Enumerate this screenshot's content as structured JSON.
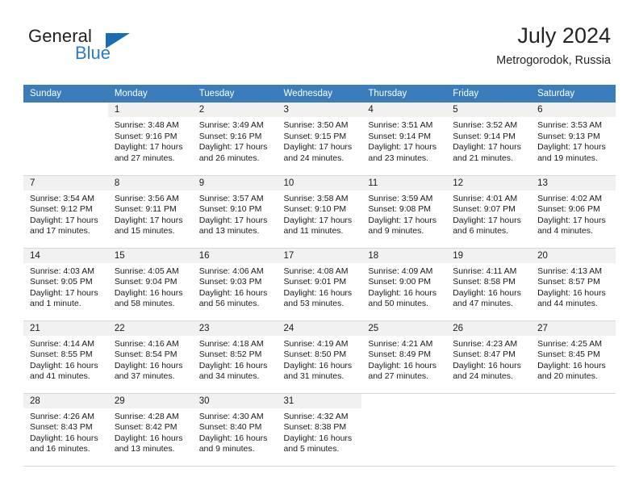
{
  "brand": {
    "name_top": "General",
    "name_bottom": "Blue",
    "triangle_icon": "brand-triangle-icon",
    "accent_color": "#2b7cc4"
  },
  "header": {
    "title": "July 2024",
    "subtitle": "Metrogorodok, Russia"
  },
  "theme": {
    "header_row_bg": "#3b7cba",
    "day_number_bg": "#f1f1f1",
    "grid_line": "#d7d7d7",
    "text": "#1a1a1a"
  },
  "weekday_headers": [
    "Sunday",
    "Monday",
    "Tuesday",
    "Wednesday",
    "Thursday",
    "Friday",
    "Saturday"
  ],
  "weeks": [
    [
      {
        "day": "",
        "sunrise": "",
        "sunset": "",
        "daylight_line1": "",
        "daylight_line2": "",
        "blank": true
      },
      {
        "day": "1",
        "sunrise": "Sunrise: 3:48 AM",
        "sunset": "Sunset: 9:16 PM",
        "daylight_line1": "Daylight: 17 hours",
        "daylight_line2": "and 27 minutes."
      },
      {
        "day": "2",
        "sunrise": "Sunrise: 3:49 AM",
        "sunset": "Sunset: 9:16 PM",
        "daylight_line1": "Daylight: 17 hours",
        "daylight_line2": "and 26 minutes."
      },
      {
        "day": "3",
        "sunrise": "Sunrise: 3:50 AM",
        "sunset": "Sunset: 9:15 PM",
        "daylight_line1": "Daylight: 17 hours",
        "daylight_line2": "and 24 minutes."
      },
      {
        "day": "4",
        "sunrise": "Sunrise: 3:51 AM",
        "sunset": "Sunset: 9:14 PM",
        "daylight_line1": "Daylight: 17 hours",
        "daylight_line2": "and 23 minutes."
      },
      {
        "day": "5",
        "sunrise": "Sunrise: 3:52 AM",
        "sunset": "Sunset: 9:14 PM",
        "daylight_line1": "Daylight: 17 hours",
        "daylight_line2": "and 21 minutes."
      },
      {
        "day": "6",
        "sunrise": "Sunrise: 3:53 AM",
        "sunset": "Sunset: 9:13 PM",
        "daylight_line1": "Daylight: 17 hours",
        "daylight_line2": "and 19 minutes."
      }
    ],
    [
      {
        "day": "7",
        "sunrise": "Sunrise: 3:54 AM",
        "sunset": "Sunset: 9:12 PM",
        "daylight_line1": "Daylight: 17 hours",
        "daylight_line2": "and 17 minutes."
      },
      {
        "day": "8",
        "sunrise": "Sunrise: 3:56 AM",
        "sunset": "Sunset: 9:11 PM",
        "daylight_line1": "Daylight: 17 hours",
        "daylight_line2": "and 15 minutes."
      },
      {
        "day": "9",
        "sunrise": "Sunrise: 3:57 AM",
        "sunset": "Sunset: 9:10 PM",
        "daylight_line1": "Daylight: 17 hours",
        "daylight_line2": "and 13 minutes."
      },
      {
        "day": "10",
        "sunrise": "Sunrise: 3:58 AM",
        "sunset": "Sunset: 9:10 PM",
        "daylight_line1": "Daylight: 17 hours",
        "daylight_line2": "and 11 minutes."
      },
      {
        "day": "11",
        "sunrise": "Sunrise: 3:59 AM",
        "sunset": "Sunset: 9:08 PM",
        "daylight_line1": "Daylight: 17 hours",
        "daylight_line2": "and 9 minutes."
      },
      {
        "day": "12",
        "sunrise": "Sunrise: 4:01 AM",
        "sunset": "Sunset: 9:07 PM",
        "daylight_line1": "Daylight: 17 hours",
        "daylight_line2": "and 6 minutes."
      },
      {
        "day": "13",
        "sunrise": "Sunrise: 4:02 AM",
        "sunset": "Sunset: 9:06 PM",
        "daylight_line1": "Daylight: 17 hours",
        "daylight_line2": "and 4 minutes."
      }
    ],
    [
      {
        "day": "14",
        "sunrise": "Sunrise: 4:03 AM",
        "sunset": "Sunset: 9:05 PM",
        "daylight_line1": "Daylight: 17 hours",
        "daylight_line2": "and 1 minute."
      },
      {
        "day": "15",
        "sunrise": "Sunrise: 4:05 AM",
        "sunset": "Sunset: 9:04 PM",
        "daylight_line1": "Daylight: 16 hours",
        "daylight_line2": "and 58 minutes."
      },
      {
        "day": "16",
        "sunrise": "Sunrise: 4:06 AM",
        "sunset": "Sunset: 9:03 PM",
        "daylight_line1": "Daylight: 16 hours",
        "daylight_line2": "and 56 minutes."
      },
      {
        "day": "17",
        "sunrise": "Sunrise: 4:08 AM",
        "sunset": "Sunset: 9:01 PM",
        "daylight_line1": "Daylight: 16 hours",
        "daylight_line2": "and 53 minutes."
      },
      {
        "day": "18",
        "sunrise": "Sunrise: 4:09 AM",
        "sunset": "Sunset: 9:00 PM",
        "daylight_line1": "Daylight: 16 hours",
        "daylight_line2": "and 50 minutes."
      },
      {
        "day": "19",
        "sunrise": "Sunrise: 4:11 AM",
        "sunset": "Sunset: 8:58 PM",
        "daylight_line1": "Daylight: 16 hours",
        "daylight_line2": "and 47 minutes."
      },
      {
        "day": "20",
        "sunrise": "Sunrise: 4:13 AM",
        "sunset": "Sunset: 8:57 PM",
        "daylight_line1": "Daylight: 16 hours",
        "daylight_line2": "and 44 minutes."
      }
    ],
    [
      {
        "day": "21",
        "sunrise": "Sunrise: 4:14 AM",
        "sunset": "Sunset: 8:55 PM",
        "daylight_line1": "Daylight: 16 hours",
        "daylight_line2": "and 41 minutes."
      },
      {
        "day": "22",
        "sunrise": "Sunrise: 4:16 AM",
        "sunset": "Sunset: 8:54 PM",
        "daylight_line1": "Daylight: 16 hours",
        "daylight_line2": "and 37 minutes."
      },
      {
        "day": "23",
        "sunrise": "Sunrise: 4:18 AM",
        "sunset": "Sunset: 8:52 PM",
        "daylight_line1": "Daylight: 16 hours",
        "daylight_line2": "and 34 minutes."
      },
      {
        "day": "24",
        "sunrise": "Sunrise: 4:19 AM",
        "sunset": "Sunset: 8:50 PM",
        "daylight_line1": "Daylight: 16 hours",
        "daylight_line2": "and 31 minutes."
      },
      {
        "day": "25",
        "sunrise": "Sunrise: 4:21 AM",
        "sunset": "Sunset: 8:49 PM",
        "daylight_line1": "Daylight: 16 hours",
        "daylight_line2": "and 27 minutes."
      },
      {
        "day": "26",
        "sunrise": "Sunrise: 4:23 AM",
        "sunset": "Sunset: 8:47 PM",
        "daylight_line1": "Daylight: 16 hours",
        "daylight_line2": "and 24 minutes."
      },
      {
        "day": "27",
        "sunrise": "Sunrise: 4:25 AM",
        "sunset": "Sunset: 8:45 PM",
        "daylight_line1": "Daylight: 16 hours",
        "daylight_line2": "and 20 minutes."
      }
    ],
    [
      {
        "day": "28",
        "sunrise": "Sunrise: 4:26 AM",
        "sunset": "Sunset: 8:43 PM",
        "daylight_line1": "Daylight: 16 hours",
        "daylight_line2": "and 16 minutes."
      },
      {
        "day": "29",
        "sunrise": "Sunrise: 4:28 AM",
        "sunset": "Sunset: 8:42 PM",
        "daylight_line1": "Daylight: 16 hours",
        "daylight_line2": "and 13 minutes."
      },
      {
        "day": "30",
        "sunrise": "Sunrise: 4:30 AM",
        "sunset": "Sunset: 8:40 PM",
        "daylight_line1": "Daylight: 16 hours",
        "daylight_line2": "and 9 minutes."
      },
      {
        "day": "31",
        "sunrise": "Sunrise: 4:32 AM",
        "sunset": "Sunset: 8:38 PM",
        "daylight_line1": "Daylight: 16 hours",
        "daylight_line2": "and 5 minutes."
      },
      {
        "day": "",
        "sunrise": "",
        "sunset": "",
        "daylight_line1": "",
        "daylight_line2": "",
        "blank": true
      },
      {
        "day": "",
        "sunrise": "",
        "sunset": "",
        "daylight_line1": "",
        "daylight_line2": "",
        "blank": true
      },
      {
        "day": "",
        "sunrise": "",
        "sunset": "",
        "daylight_line1": "",
        "daylight_line2": "",
        "blank": true
      }
    ]
  ]
}
